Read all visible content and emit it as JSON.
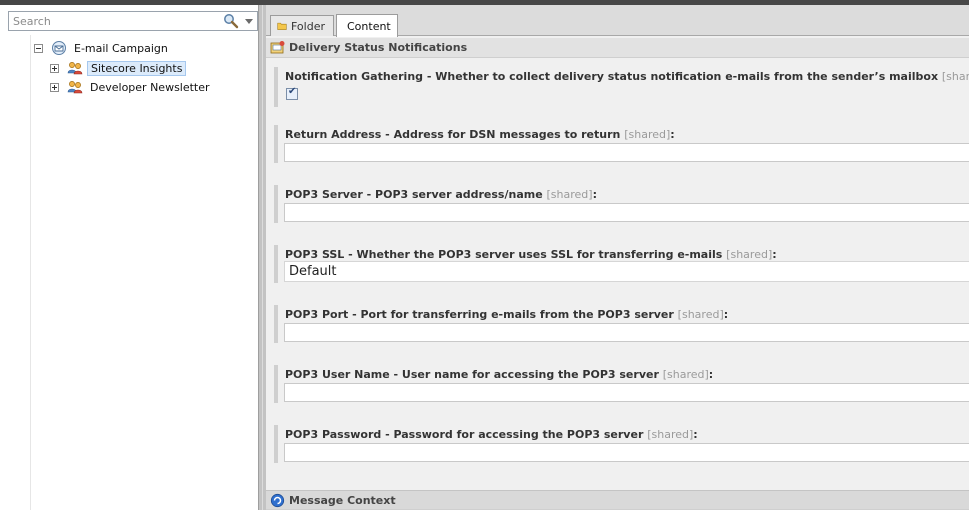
{
  "search": {
    "placeholder": "Search"
  },
  "tree": {
    "root": {
      "label": "E-mail Campaign"
    },
    "children": [
      {
        "label": "Sitecore Insights"
      },
      {
        "label": "Developer Newsletter"
      }
    ]
  },
  "tabs": {
    "folder": "Folder",
    "content": "Content"
  },
  "section": {
    "title": "Delivery Status Notifications"
  },
  "fields": {
    "notification_gathering": {
      "label": "Notification Gathering - Whether to collect delivery status notification e-mails from the sender’s mailbox",
      "shared": "[shared]",
      "checked": true
    },
    "return_address": {
      "label": "Return Address - Address for DSN messages to return",
      "shared": "[shared]",
      "value": ""
    },
    "pop3_server": {
      "label": "POP3 Server - POP3 server address/name",
      "shared": "[shared]",
      "value": ""
    },
    "pop3_ssl": {
      "label": "POP3 SSL - Whether the POP3 server uses SSL for transferring e-mails",
      "shared": "[shared]",
      "value": "Default"
    },
    "pop3_port": {
      "label": "POP3 Port - Port for transferring e-mails from the POP3 server",
      "shared": "[shared]",
      "value": ""
    },
    "pop3_user": {
      "label": "POP3 User Name - User name for accessing the POP3 server",
      "shared": "[shared]",
      "value": ""
    },
    "pop3_password": {
      "label": "POP3 Password - Password for accessing the POP3 server",
      "shared": "[shared]",
      "value": ""
    }
  },
  "section2": {
    "title": "Message Context"
  },
  "colon": ":"
}
